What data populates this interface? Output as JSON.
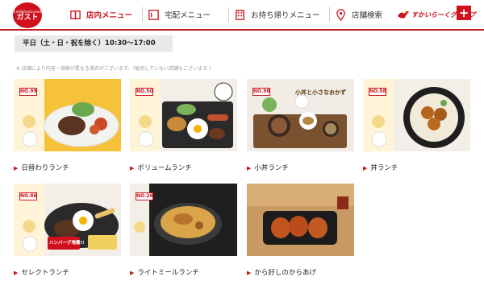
{
  "brand": {
    "logo_sub": "Café&Restaurant",
    "logo_main": "ガスト",
    "group": "すかいらーくグループ"
  },
  "nav": {
    "items": [
      {
        "label": "店内メニュー",
        "icon": "book-icon",
        "active": true
      },
      {
        "label": "宅配メニュー",
        "icon": "menu-list-icon",
        "active": false
      },
      {
        "label": "お持ち帰りメニュー",
        "icon": "building-icon",
        "active": false
      },
      {
        "label": "店舗検索",
        "icon": "map-pin-icon",
        "active": false
      }
    ],
    "plus": "+"
  },
  "hours": "平日（土・日・祝を除く）10:30〜17:00",
  "note": "※ 店舗により内容・価格が異なる場合がございます。（販売していない店舗もございます。）",
  "colors": {
    "accent": "#c8161d"
  },
  "cards": [
    {
      "label": "日替わりランチ",
      "no": "NO.99"
    },
    {
      "label": "ボリュームランチ",
      "no": "NO.50"
    },
    {
      "label": "小丼ランチ",
      "no": "NO.98",
      "caption": "小丼と小さなおかず"
    },
    {
      "label": "丼ランチ",
      "no": "NO.58"
    },
    {
      "label": "セレクトランチ",
      "no": "NO.86",
      "caption": "ハンバーグ増量!!"
    },
    {
      "label": "ライトミールランチ",
      "no": "NO.26"
    },
    {
      "label": "から好しのからあげ"
    }
  ]
}
